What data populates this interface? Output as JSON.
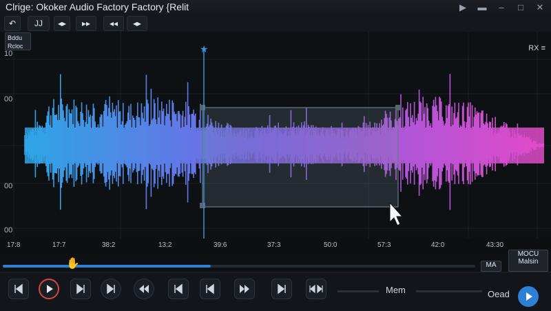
{
  "window": {
    "title": "Clrige: Okoker Audio Factory Factory  {Relit"
  },
  "toolbar": {
    "undo_label": "↶",
    "b1_label": "JJ",
    "b2_label": "◂▸",
    "b3_label": "▸▸",
    "b4_label": "◂◂",
    "b5_label": "◂▸"
  },
  "overlay": {
    "badge_line1": "Bddu",
    "badge_line2": "Rcloc",
    "top_right_label": "RX ≡"
  },
  "yaxis": {
    "labels": [
      "10",
      "00",
      "00",
      "00"
    ]
  },
  "time_ruler": {
    "ticks": [
      "17:8",
      "17:7",
      "38:2",
      "13:2",
      "39:6",
      "37:3",
      "50:0",
      "57:3",
      "42:0",
      "43:30"
    ]
  },
  "right_info": {
    "box1": "MA",
    "box2_line1": "MOCU",
    "box2_line2": "Malsin"
  },
  "transport": {
    "mem_label": "Mem",
    "load_label": "Oead"
  },
  "colors": {
    "waveform_start": "#2da6e6",
    "waveform_mid": "#7b62e6",
    "waveform_end": "#e24ac9",
    "selection_stroke": "#6e7a86",
    "selection_fill": "rgba(120,140,160,0.22)",
    "playhead": "#3a8fd8",
    "accent": "#2e7fd6"
  },
  "progress": {
    "fraction": 0.44
  }
}
